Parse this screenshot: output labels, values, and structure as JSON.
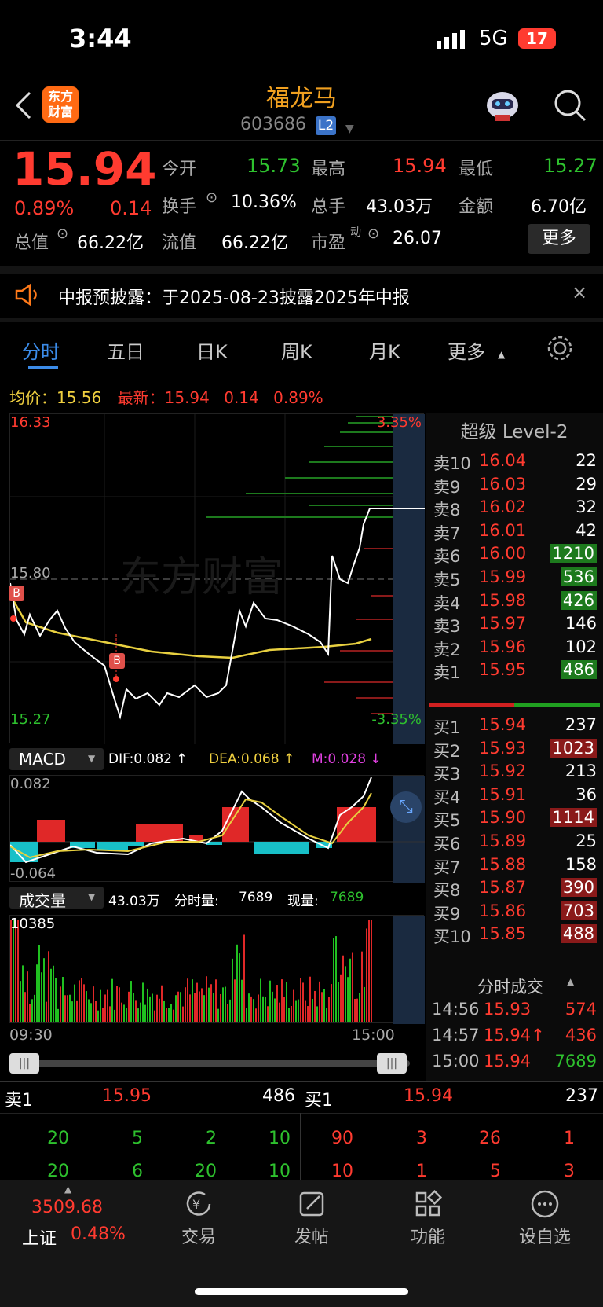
{
  "status": {
    "time": "3:44",
    "network": "5G",
    "battery": "17"
  },
  "header": {
    "name": "福龙马",
    "code": "603686",
    "l2": "L2",
    "logo_line1": "东方",
    "logo_line2": "财富"
  },
  "quote": {
    "price": "15.94",
    "pct": "0.89%",
    "chg": "0.14",
    "f": [
      {
        "l": "今开",
        "v": "15.73"
      },
      {
        "l": "最高",
        "v": "15.94"
      },
      {
        "l": "最低",
        "v": "15.27"
      },
      {
        "l": "换手",
        "v": "10.36%"
      },
      {
        "l": "总手",
        "v": "43.03万"
      },
      {
        "l": "金额",
        "v": "6.70亿"
      },
      {
        "l": "总值",
        "v": "66.22亿"
      },
      {
        "l": "流值",
        "v": "66.22亿"
      },
      {
        "l": "市盈",
        "sup": "动",
        "v": "26.07"
      }
    ],
    "more": "更多"
  },
  "notice": "中报预披露：于2025-08-23披露2025年中报",
  "tabs": [
    "分时",
    "五日",
    "日K",
    "周K",
    "月K",
    "更多"
  ],
  "avg_line": {
    "avg_label": "均价：",
    "avg": "15.56",
    "new_label": "最新：",
    "new": "15.94",
    "chg": "0.14",
    "pct": "0.89%"
  },
  "chart": {
    "ymax": "16.33",
    "ymin": "15.27",
    "ref": "15.80",
    "pmax": "3.35%",
    "pmin": "-3.35%",
    "t_start": "09:30",
    "t_end": "15:00",
    "b1": "B",
    "b2": "B",
    "watermark": "东方财富"
  },
  "macd": {
    "title": "MACD",
    "dif": "DIF:0.082 ↑",
    "dea": "DEA:0.068 ↑",
    "m": "M:0.028 ↓",
    "max": "0.082",
    "min": "-0.064"
  },
  "volume": {
    "title": "成交量",
    "total": "43.03万",
    "fs_label": "分时量:",
    "fs": "7689",
    "xl_label": "现量:",
    "xl": "7689",
    "max": "10385"
  },
  "level2": {
    "title": "超级 Level-2",
    "asks": [
      [
        "卖10",
        "16.04",
        "22"
      ],
      [
        "卖9",
        "16.03",
        "29"
      ],
      [
        "卖8",
        "16.02",
        "32"
      ],
      [
        "卖7",
        "16.01",
        "42"
      ],
      [
        "卖6",
        "16.00",
        "1210"
      ],
      [
        "卖5",
        "15.99",
        "536"
      ],
      [
        "卖4",
        "15.98",
        "426"
      ],
      [
        "卖3",
        "15.97",
        "146"
      ],
      [
        "卖2",
        "15.96",
        "102"
      ],
      [
        "卖1",
        "15.95",
        "486"
      ]
    ],
    "bids": [
      [
        "买1",
        "15.94",
        "237"
      ],
      [
        "买2",
        "15.93",
        "1023"
      ],
      [
        "买3",
        "15.92",
        "213"
      ],
      [
        "买4",
        "15.91",
        "36"
      ],
      [
        "买5",
        "15.90",
        "1114"
      ],
      [
        "买6",
        "15.89",
        "25"
      ],
      [
        "买7",
        "15.88",
        "158"
      ],
      [
        "买8",
        "15.87",
        "390"
      ],
      [
        "买9",
        "15.86",
        "703"
      ],
      [
        "买10",
        "15.85",
        "488"
      ]
    ]
  },
  "ticks": {
    "title": "分时成交",
    "rows": [
      [
        "14:56",
        "15.93",
        "574"
      ],
      [
        "14:57",
        "15.94↑",
        "436"
      ],
      [
        "15:00",
        "15.94",
        "7689"
      ]
    ]
  },
  "queue": {
    "sell_label": "卖1",
    "sell_price": "15.95",
    "sell_vol": "486",
    "buy_label": "买1",
    "buy_price": "15.94",
    "buy_vol": "237",
    "sell_rows": [
      [
        "20",
        "5",
        "2",
        "10"
      ],
      [
        "20",
        "6",
        "20",
        "10"
      ]
    ],
    "buy_rows": [
      [
        "90",
        "3",
        "26",
        "1"
      ],
      [
        "10",
        "1",
        "5",
        "3"
      ]
    ]
  },
  "bottom": {
    "index_value": "3509.68",
    "index_name": "上证",
    "index_pct": "0.48%",
    "items": [
      "交易",
      "发帖",
      "功能",
      "设自选"
    ]
  },
  "chart_data": {
    "type": "line",
    "x_range": [
      "09:30",
      "15:00"
    ],
    "ylim": [
      15.27,
      16.33
    ],
    "ref": 15.8,
    "series": [
      {
        "values": [
          15.8,
          15.56,
          15.48,
          15.45,
          15.4,
          15.38,
          15.4,
          15.42,
          15.6,
          15.62,
          15.66,
          15.6,
          15.58,
          15.94
        ]
      }
    ]
  }
}
